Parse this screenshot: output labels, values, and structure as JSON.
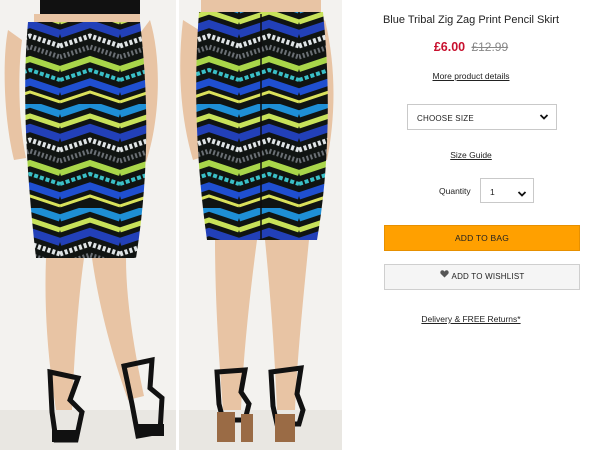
{
  "product": {
    "title": "Blue Tribal Zig Zag Print Pencil Skirt",
    "price_now": "£6.00",
    "price_was": "£12.99",
    "more_details_link": "More product details"
  },
  "size": {
    "placeholder": "CHOOSE SIZE",
    "icon": "chevron-down-icon"
  },
  "size_guide_link": "Size Guide",
  "quantity": {
    "label": "Quantity",
    "value": "1",
    "icon": "chevron-down-icon"
  },
  "actions": {
    "add_to_bag": "ADD TO BAG",
    "add_to_wishlist": "ADD TO WISHLIST",
    "wishlist_icon": "heart-icon"
  },
  "delivery_link": "Delivery & FREE Returns*",
  "colors": {
    "price": "#c8102e",
    "add_to_bag_bg": "#ffa000",
    "wishlist_bg": "#f5f5f5"
  }
}
